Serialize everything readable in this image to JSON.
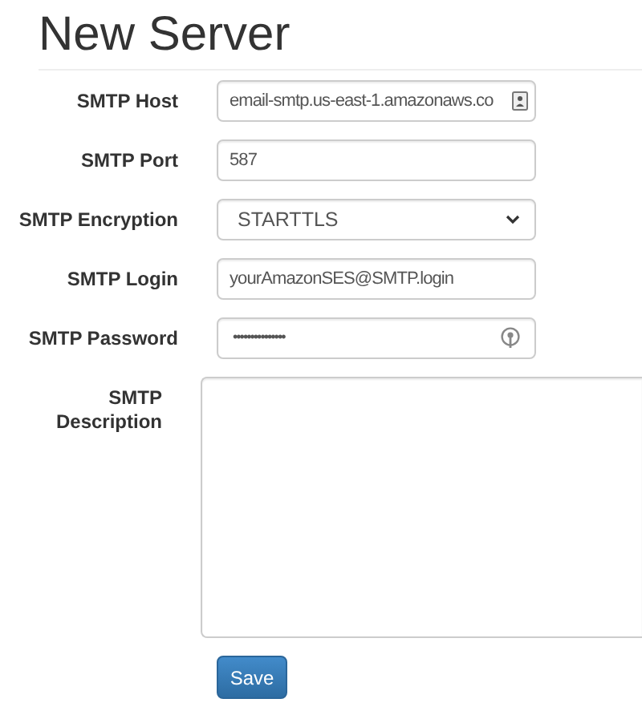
{
  "title": "New Server",
  "fields": [
    {
      "label": "SMTP Host",
      "kind": "text",
      "value": "email-smtp.us-east-1.amazonaws.co",
      "autofill": true
    },
    {
      "label": "SMTP Port",
      "kind": "text",
      "value": "587",
      "autofill": false
    },
    {
      "label": "SMTP Encryption",
      "kind": "select",
      "value": "STARTTLS"
    },
    {
      "label": "SMTP Login",
      "kind": "text",
      "value": "yourAmazonSES@SMTP.login",
      "autofill": false
    },
    {
      "label": "SMTP Password",
      "kind": "password",
      "value": "•••••••••••••••"
    },
    {
      "label": "SMTP Description",
      "kind": "textarea"
    }
  ],
  "save_button": "Save"
}
